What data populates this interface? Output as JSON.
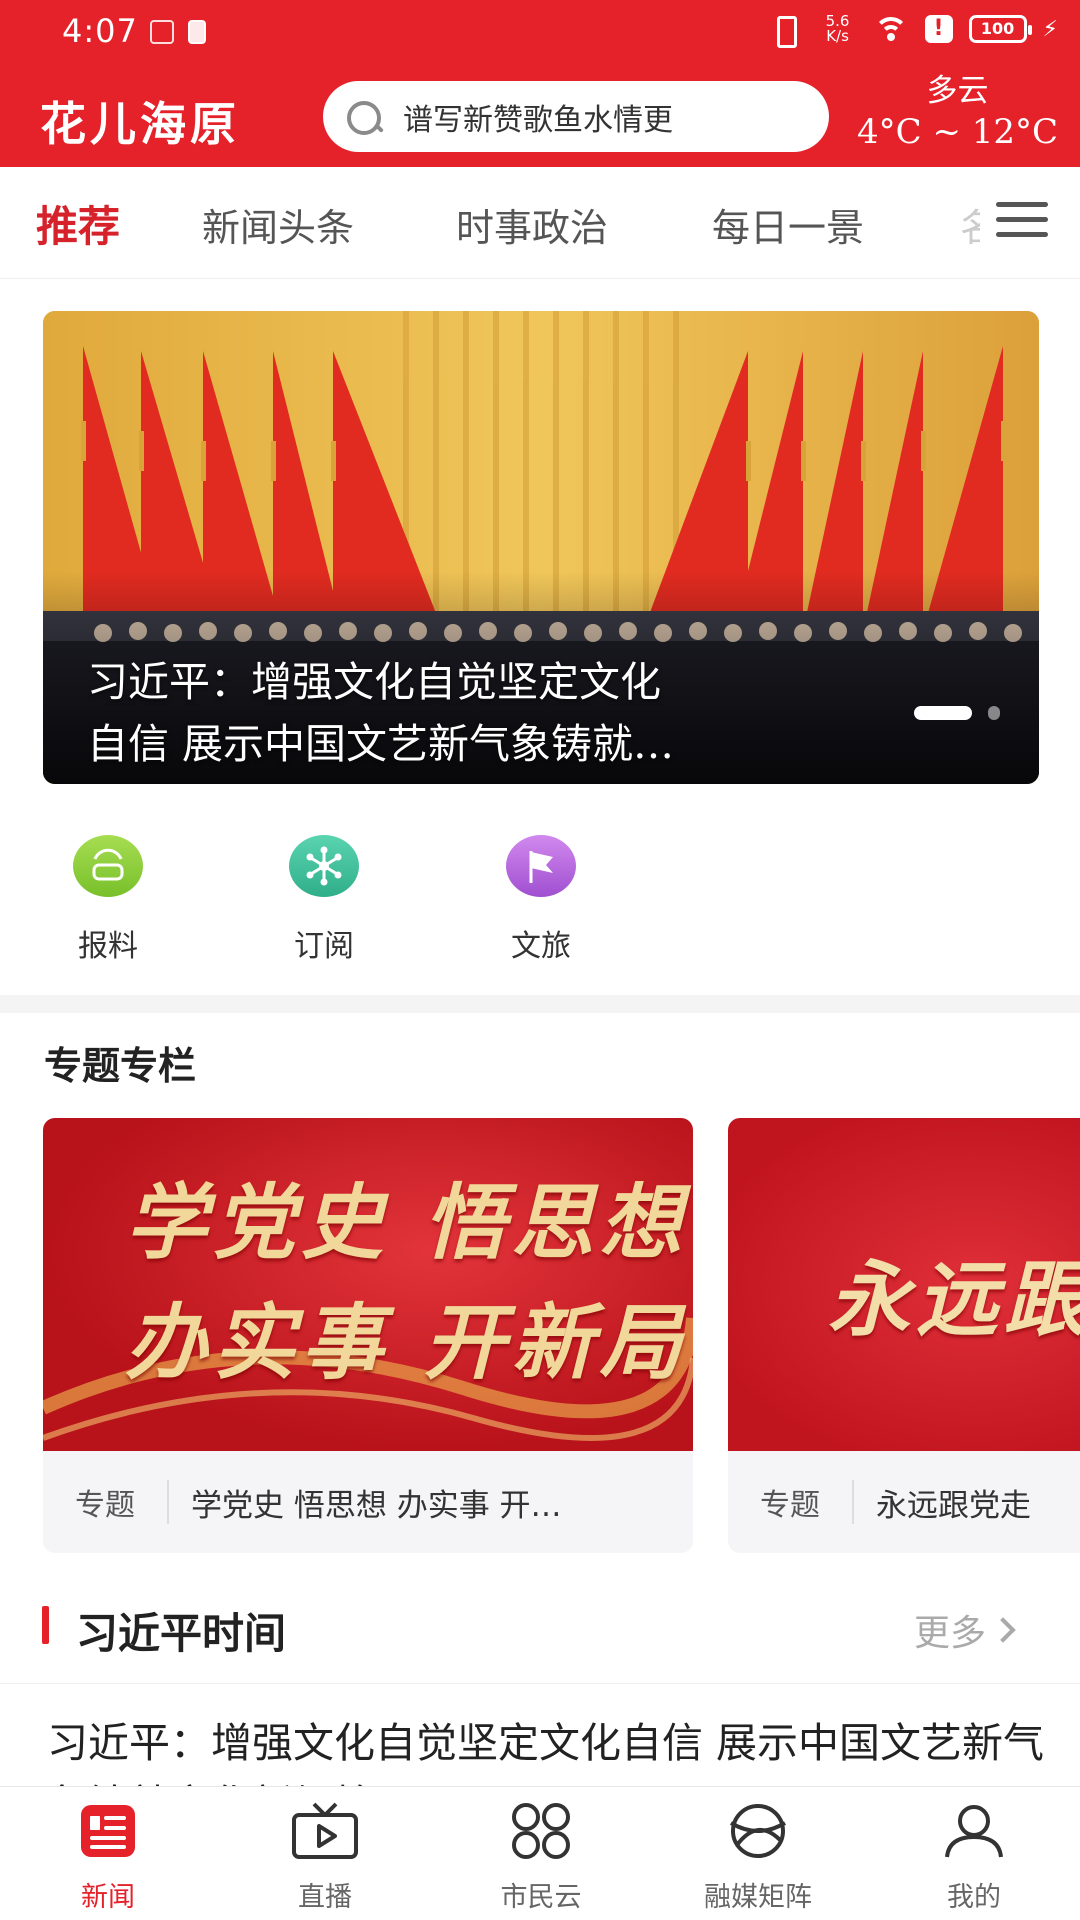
{
  "status_bar": {
    "time": "4:07",
    "net_speed_value": "5.6",
    "net_speed_unit": "K/s",
    "battery": "100"
  },
  "header": {
    "app_title": "花儿海原",
    "search_placeholder": "谱写新赞歌鱼水情更",
    "weather_condition": "多云",
    "weather_temp": "4°C ~ 12°C"
  },
  "tabs": [
    {
      "label": "推荐",
      "active": true
    },
    {
      "label": "新闻头条",
      "active": false
    },
    {
      "label": "时事政治",
      "active": false
    },
    {
      "label": "每日一景",
      "active": false
    },
    {
      "label": "名",
      "active": false
    }
  ],
  "banner": {
    "caption_line1": "习近平：增强文化自觉坚定文化",
    "caption_line2": "自信 展示中国文艺新气象铸就…"
  },
  "quick_actions": [
    {
      "label": "报料",
      "icon": "report-icon",
      "color": "#8ccc3a"
    },
    {
      "label": "订阅",
      "icon": "subscribe-icon",
      "color": "#3dbf9a"
    },
    {
      "label": "文旅",
      "icon": "culture-travel-icon",
      "color": "#b55fd8"
    }
  ],
  "topics_section": {
    "title": "专题专栏",
    "cards": [
      {
        "image_text_line1": "学党史 悟思想",
        "image_text_line2": "办实事 开新局",
        "tag": "专题",
        "name": "学党史 悟思想 办实事 开…"
      },
      {
        "image_text_line1": "永远跟",
        "tag": "专题",
        "name": "永远跟党走"
      }
    ]
  },
  "xi_section": {
    "title": "习近平时间",
    "more_label": "更多",
    "article_title": "习近平：增强文化自觉坚定文化自信 展示中国文艺新气象铸就文化新辉煌"
  },
  "bottom_nav": [
    {
      "label": "新闻",
      "icon": "news-icon",
      "active": true
    },
    {
      "label": "直播",
      "icon": "live-tv-icon",
      "active": false
    },
    {
      "label": "市民云",
      "icon": "citizen-cloud-icon",
      "active": false
    },
    {
      "label": "融媒矩阵",
      "icon": "media-matrix-icon",
      "active": false
    },
    {
      "label": "我的",
      "icon": "profile-icon",
      "active": false
    }
  ],
  "colors": {
    "brand_red": "#e5212a",
    "active_tab": "#d6222a",
    "gold_text": "#f2d79a"
  }
}
